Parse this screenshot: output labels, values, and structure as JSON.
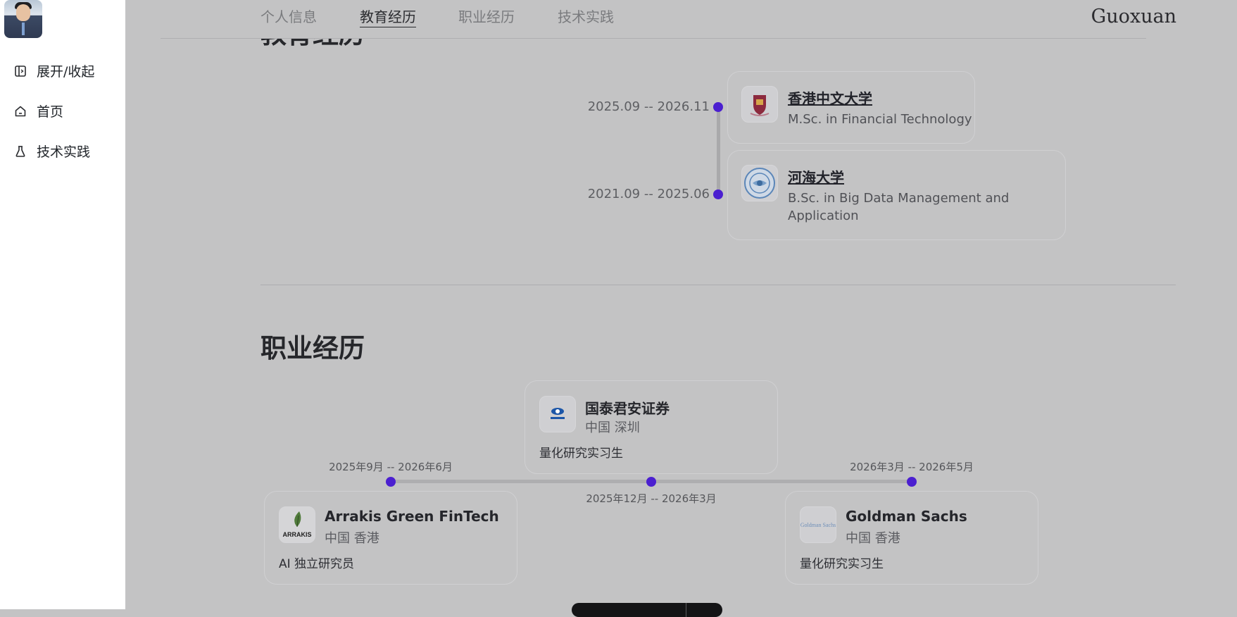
{
  "sidebar": {
    "items": [
      {
        "label": "展开/收起",
        "icon": "sidebar-toggle-icon"
      },
      {
        "label": "首页",
        "icon": "home-icon"
      },
      {
        "label": "技术实践",
        "icon": "flask-icon"
      }
    ]
  },
  "nav": {
    "tabs": [
      "个人信息",
      "教育经历",
      "职业经历",
      "技术实践"
    ],
    "active_tab": "教育经历",
    "brand": "Guoxuan"
  },
  "education": {
    "heading": "教育经历",
    "items": [
      {
        "date": "2025.09 -- 2026.11",
        "school": "香港中文大学",
        "degree": "M.Sc. in Financial Technology",
        "logo": "cuhk-crest-icon"
      },
      {
        "date": "2021.09 -- 2025.06",
        "school": "河海大学",
        "degree": "B.Sc. in Big Data Management and Application",
        "logo": "hohai-seal-icon"
      }
    ]
  },
  "career": {
    "heading": "职业经历",
    "items": [
      {
        "date": "2025年9月 -- 2026年6月",
        "company": "Arrakis Green FinTech",
        "location": "中国 香港",
        "role": "AI 独立研究员",
        "logo": "arrakis-leaf-icon",
        "logo_text": "ARRAKIS"
      },
      {
        "date": "2025年12月 -- 2026年3月",
        "company": "国泰君安证券",
        "location": "中国 深圳",
        "role": "量化研究实习生",
        "logo": "gtja-logo-icon"
      },
      {
        "date": "2026年3月 -- 2026年5月",
        "company": "Goldman Sachs",
        "location": "中国 香港",
        "role": "量化研究实习生",
        "logo": "goldman-sachs-logo-icon",
        "logo_text": "Goldman Sachs"
      }
    ]
  },
  "colors": {
    "accent": "#4b1fd0",
    "overlay": "#c3c3c4"
  }
}
